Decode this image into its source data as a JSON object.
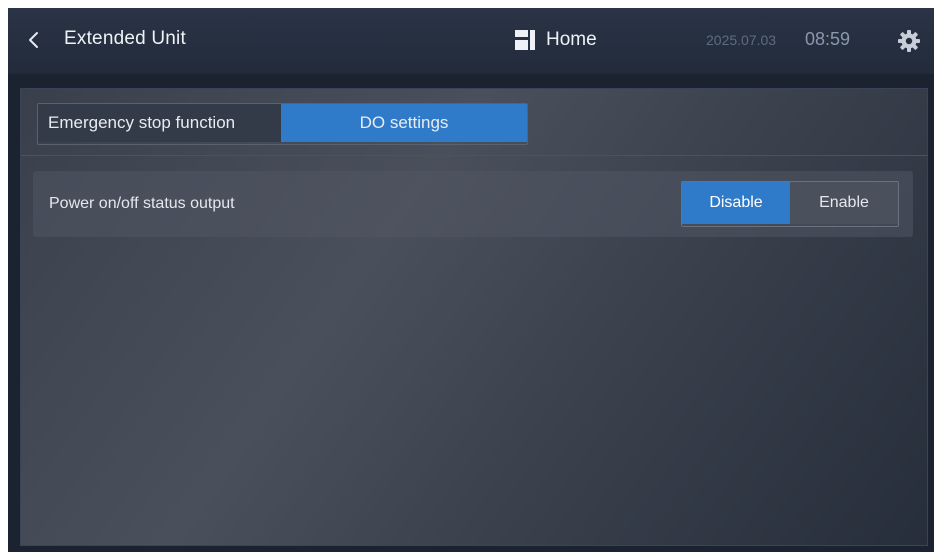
{
  "header": {
    "title": "Extended Unit",
    "home_label": "Home",
    "date": "2025.07.03",
    "time": "08:59",
    "icons": {
      "back": "chevron-left-icon",
      "home": "home-grid-icon",
      "settings": "gear-icon"
    }
  },
  "tabs": [
    {
      "label": "Emergency stop function",
      "selected": false
    },
    {
      "label": "DO settings",
      "selected": true
    }
  ],
  "settings": [
    {
      "label": "Power on/off status output",
      "options": [
        "Disable",
        "Enable"
      ],
      "selected": "Disable"
    }
  ],
  "colors": {
    "accent": "#2f7bc9",
    "header_bg": "#252e3e",
    "panel_bg": "#3f4550"
  }
}
